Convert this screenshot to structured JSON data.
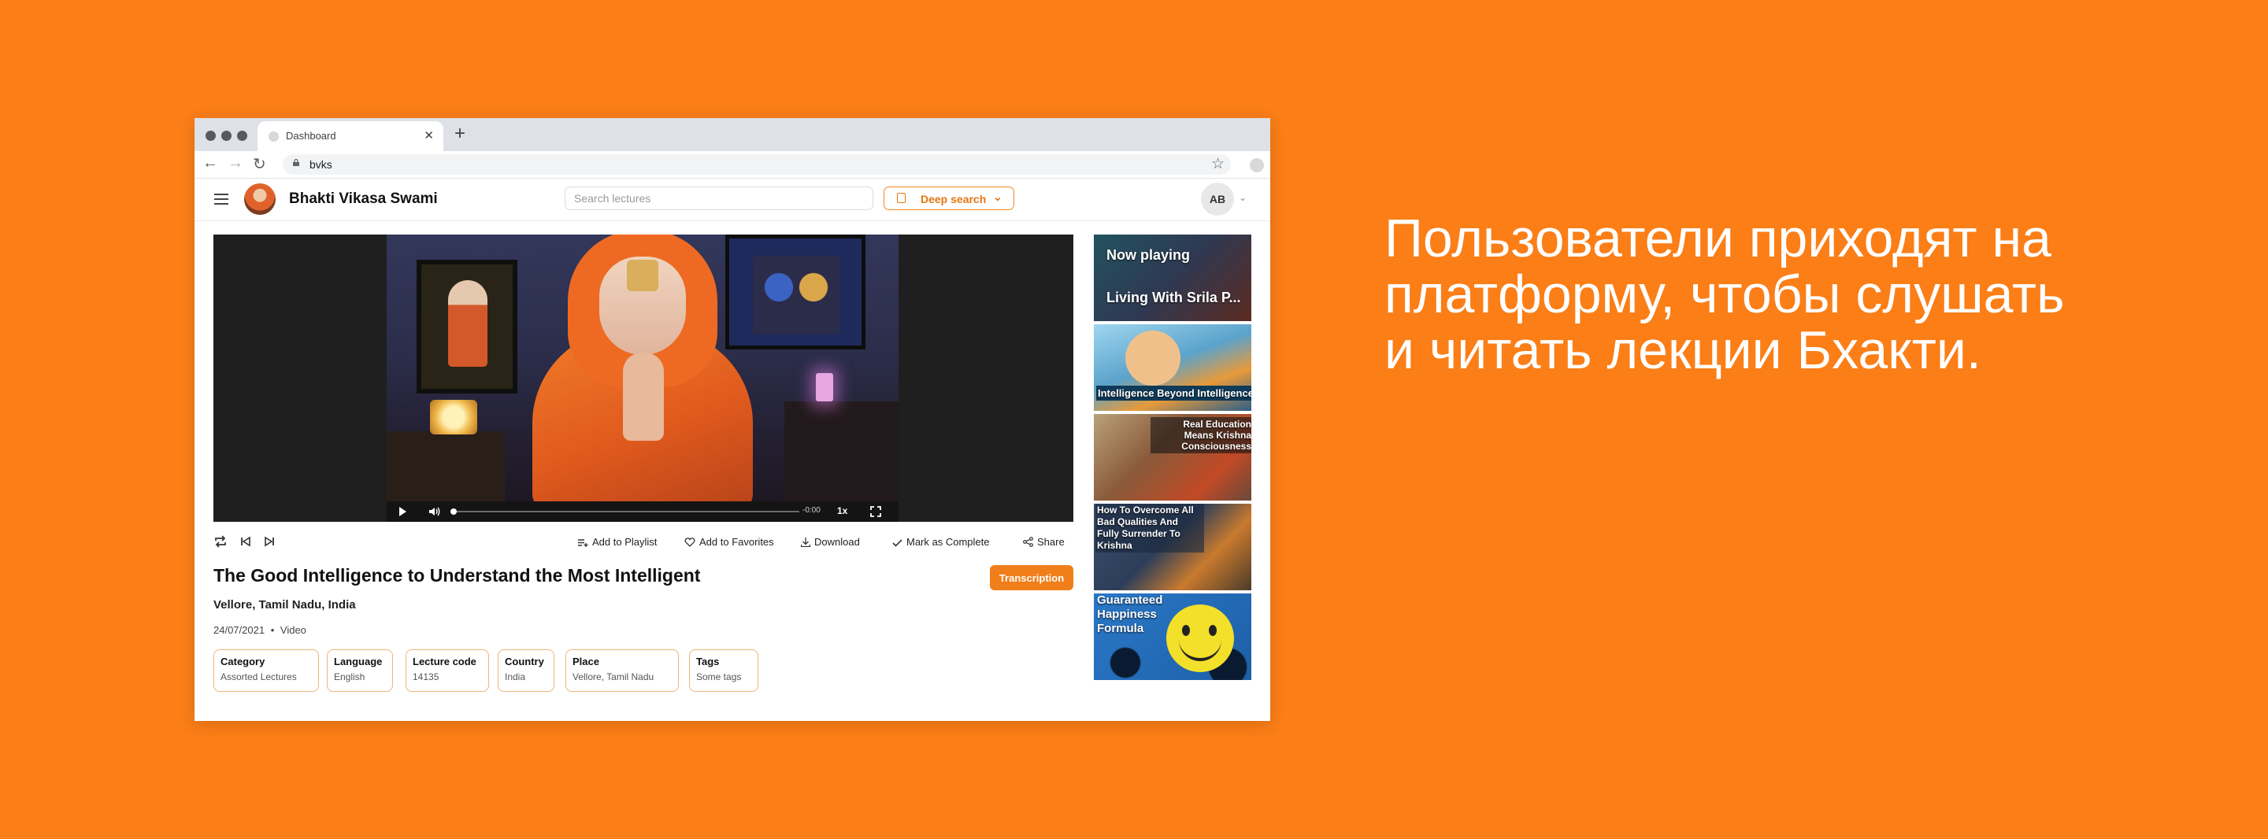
{
  "browser": {
    "tab_title": "Dashboard",
    "url": "bvks"
  },
  "header": {
    "brand": "Bhakti Vikasa Swami",
    "search_placeholder": "Search lectures",
    "deep_search_label": "Deep search",
    "user_initials": "AB"
  },
  "player": {
    "time": "-0:00",
    "speed": "1x",
    "progress": 0.0
  },
  "actions": {
    "add_to_playlist": "Add to Playlist",
    "add_to_favorites": "Add to Favorites",
    "download": "Download",
    "mark_as_complete": "Mark as Complete",
    "share": "Share"
  },
  "lecture": {
    "title": "The Good Intelligence to Understand the Most Intelligent",
    "location": "Vellore, Tamil Nadu, India",
    "date": "24/07/2021",
    "separator": "•",
    "type": "Video",
    "transcription_label": "Transcription",
    "details": [
      {
        "label": "Category",
        "value": "Assorted Lectures"
      },
      {
        "label": "Language",
        "value": "English"
      },
      {
        "label": "Lecture code",
        "value": "14135"
      },
      {
        "label": "Country",
        "value": "India"
      },
      {
        "label": "Place",
        "value": "Vellore, Tamil Nadu"
      },
      {
        "label": "Tags",
        "value": "Some tags"
      }
    ]
  },
  "playlist": [
    {
      "status": "Now playing",
      "title": "Living With Srila P..."
    },
    {
      "title": "Intelligence Beyond Intelligence"
    },
    {
      "title": "Real Education Means Krishna Consciousness"
    },
    {
      "title": "How To Overcome All Bad Qualities And Fully Surrender To Krishna"
    },
    {
      "title": "Guaranteed Happiness Formula"
    }
  ],
  "tagline": "Пользователи приходят на платформу, чтобы слушать и читать лекции Бхакти.",
  "colors": {
    "background": "#FB7E17",
    "accent": "#F07E1A",
    "chip_border": "#F0B57A"
  },
  "icons": [
    "hamburger-icon",
    "search-icon",
    "document-icon",
    "chevron-down-icon",
    "play-icon",
    "volume-icon",
    "fullscreen-icon",
    "repeat-icon",
    "previous-icon",
    "next-icon",
    "playlist-add-icon",
    "heart-icon",
    "download-icon",
    "check-icon",
    "share-icon",
    "lock-icon",
    "star-icon",
    "back-icon",
    "forward-icon",
    "reload-icon"
  ]
}
